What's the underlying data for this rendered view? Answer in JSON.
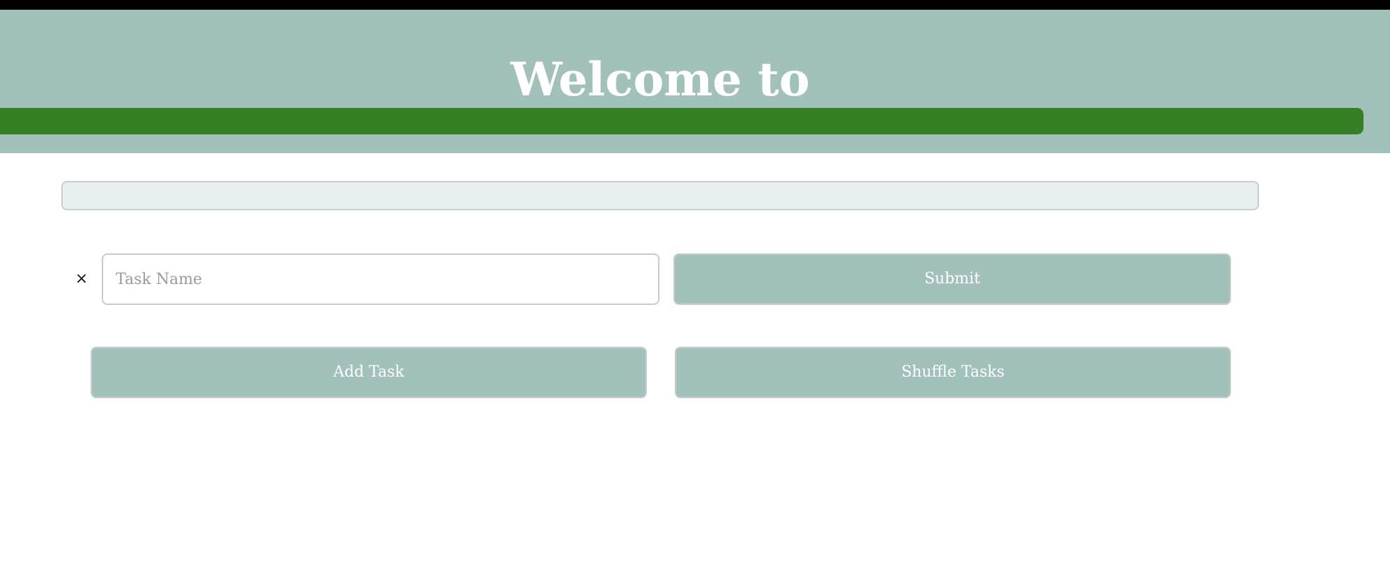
{
  "header": {
    "title": "Welcome to",
    "progress_percent": 100,
    "colors": {
      "header_bg": "#a2c1ba",
      "progress_fill": "#377f24",
      "title_text": "#ffffff"
    }
  },
  "filter_bar": {
    "value": ""
  },
  "task_form": {
    "close_icon": "close-icon",
    "close_glyph": "×",
    "input_placeholder": "Task Name",
    "input_value": "",
    "submit_label": "Submit"
  },
  "actions": {
    "add_task_label": "Add Task",
    "shuffle_tasks_label": "Shuffle Tasks"
  },
  "colors": {
    "accent": "#a2c1ba",
    "filter_bg": "#e7eff1"
  }
}
